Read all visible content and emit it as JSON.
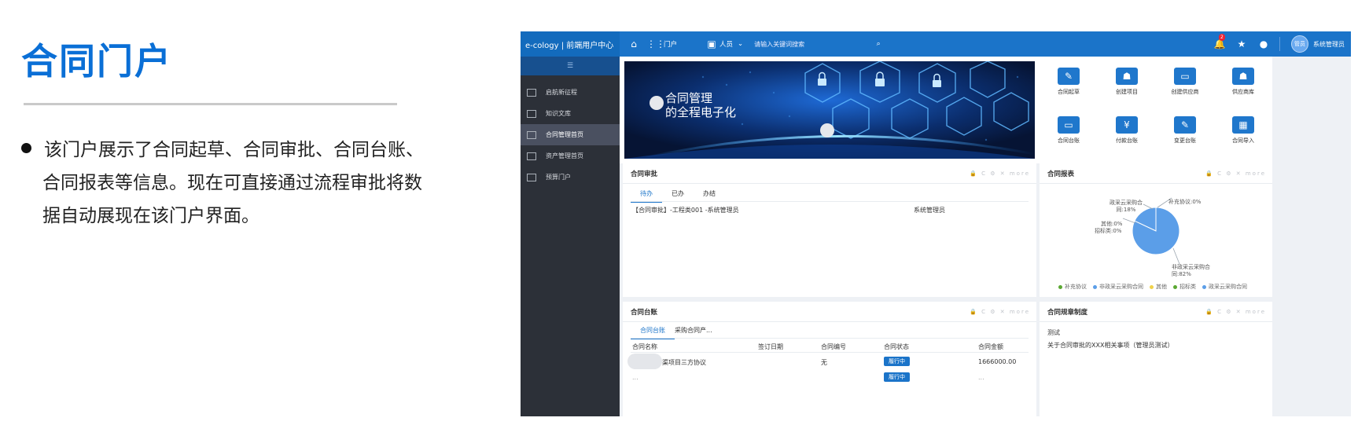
{
  "slide": {
    "title": "合同门户",
    "desc_line1": "该门户展示了合同起草、合同审批、合同台账、",
    "desc_line2": "合同报表等信息。现在可直接通过流程审批将数",
    "desc_line3": "据自动展现在该门户界面。"
  },
  "topbar": {
    "brand": "e-cology | 前端用户中心",
    "portal": "门户",
    "people": "人员",
    "search_placeholder": "请输入关键词搜索",
    "notification_count": "2",
    "avatar_label": "管员",
    "user": "系统管理员"
  },
  "sidebar": {
    "items": [
      {
        "label": "启航新征程"
      },
      {
        "label": "知识文库"
      },
      {
        "label": "合同管理首页"
      },
      {
        "label": "资产管理首页"
      },
      {
        "label": "预算门户"
      }
    ],
    "active_index": 2
  },
  "banner": {
    "line1": "合同管理",
    "line2": "的全程电子化"
  },
  "quick_links": [
    {
      "label": "合同起草",
      "icon": "contract-draft-icon"
    },
    {
      "label": "创建项目",
      "icon": "create-project-icon"
    },
    {
      "label": "创建供应商",
      "icon": "create-supplier-icon"
    },
    {
      "label": "供应商库",
      "icon": "supplier-library-icon"
    },
    {
      "label": "合同台账",
      "icon": "contract-ledger-icon"
    },
    {
      "label": "付款台账",
      "icon": "payment-ledger-icon"
    },
    {
      "label": "变更台账",
      "icon": "change-ledger-icon"
    },
    {
      "label": "合同导入",
      "icon": "contract-import-icon"
    }
  ],
  "approval": {
    "title": "合同审批",
    "controls": "🔒 C ⚙ ✕ more",
    "tabs": [
      "待办",
      "已办",
      "办结"
    ],
    "row": {
      "subject": "【合同审批】-工程类001 -系统管理员",
      "person": "系统管理员"
    }
  },
  "report": {
    "title": "合同报表",
    "controls": "🔒 C ⚙ ✕ more",
    "labels": {
      "a": "政采云采购合同:18%",
      "b": "补充协议:0%",
      "c": "其他:0%",
      "d": "招标类:0%",
      "e": "非政采云采购合同:82%"
    },
    "legend": [
      {
        "name": "补充协议",
        "color": "#5aa832"
      },
      {
        "name": "非政采云采购合同",
        "color": "#5b9ee8"
      },
      {
        "name": "其他",
        "color": "#f0d24a"
      },
      {
        "name": "招标类",
        "color": "#5aa832"
      },
      {
        "name": "政采云采购合同",
        "color": "#5b9ee8"
      }
    ]
  },
  "chart_data": {
    "type": "pie",
    "categories": [
      "补充协议",
      "非政采云采购合同",
      "其他",
      "招标类",
      "政采云采购合同"
    ],
    "values": [
      0,
      82,
      0,
      0,
      18
    ],
    "colors": [
      "#5aa832",
      "#5b9ee8",
      "#f0d24a",
      "#5aa832",
      "#5b9ee8"
    ],
    "title": "合同报表",
    "legend_position": "bottom"
  },
  "ledger": {
    "title": "合同台账",
    "controls": "🔒 C ⚙ ✕ more",
    "tabs": [
      "合同台账",
      "采购合同产..."
    ],
    "columns": [
      "合同名称",
      "签订日期",
      "合同编号",
      "合同状态",
      "合同金额"
    ],
    "rows": [
      {
        "name": "渠项目三方协议",
        "date": "",
        "number": "无",
        "status": "履行中",
        "amount": "1666000.00"
      },
      {
        "name": "...",
        "date": "",
        "number": "",
        "status": "履行中",
        "amount": "..."
      }
    ]
  },
  "rules": {
    "title": "合同规章制度",
    "controls": "🔒 C ⚙ ✕ more",
    "item1": "测试",
    "item2": "关于合同审批的XXX相关事项（管理员测试）"
  }
}
